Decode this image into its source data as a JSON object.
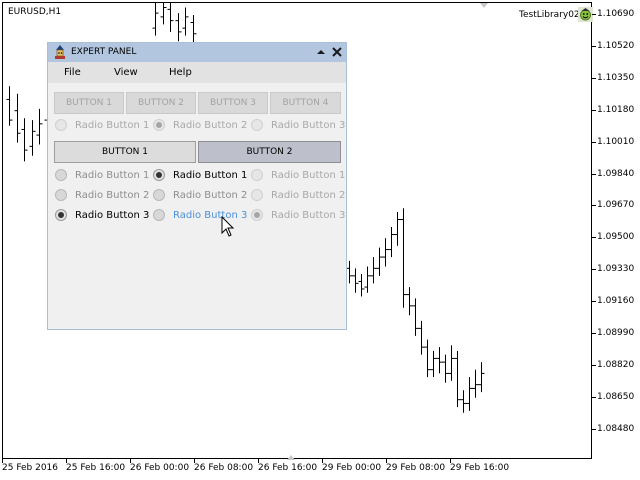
{
  "chart": {
    "symbol": "EURUSD,H1",
    "expert_name": "TestLibrary02",
    "price_labels": [
      "1.10690",
      "1.10520",
      "1.10350",
      "1.10180",
      "1.10010",
      "1.09840",
      "1.09670",
      "1.09500",
      "1.09330",
      "1.09160",
      "1.08990",
      "1.08820",
      "1.08650",
      "1.08480"
    ],
    "date_labels": [
      "25 Feb 2016",
      "25 Feb 16:00",
      "26 Feb 00:00",
      "26 Feb 08:00",
      "26 Feb 16:00",
      "29 Feb 00:00",
      "29 Feb 08:00",
      "29 Feb 16:00"
    ]
  },
  "panel": {
    "title": "EXPERT PANEL",
    "menu": [
      {
        "label": "File"
      },
      {
        "label": "View"
      },
      {
        "label": "Help"
      }
    ],
    "disabled_buttons": [
      {
        "label": "BUTTON 1"
      },
      {
        "label": "BUTTON 2"
      },
      {
        "label": "BUTTON 3"
      },
      {
        "label": "BUTTON 4"
      }
    ],
    "disabled_radios": [
      {
        "label": "Radio Button 1",
        "checked": false
      },
      {
        "label": "Radio Button 2",
        "checked": true
      },
      {
        "label": "Radio Button 3",
        "checked": false
      }
    ],
    "tab_buttons": [
      {
        "label": "BUTTON 1",
        "pressed": false
      },
      {
        "label": "BUTTON 2",
        "pressed": true
      }
    ],
    "radio_columns": [
      {
        "items": [
          {
            "label": "Radio Button 1",
            "checked": false,
            "state": "inactive"
          },
          {
            "label": "Radio Button 2",
            "checked": false,
            "state": "inactive"
          },
          {
            "label": "Radio Button 3",
            "checked": true,
            "state": "active"
          }
        ]
      },
      {
        "items": [
          {
            "label": "Radio Button 1",
            "checked": true,
            "state": "active"
          },
          {
            "label": "Radio Button 2",
            "checked": false,
            "state": "inactive"
          },
          {
            "label": "Radio Button 3",
            "checked": false,
            "state": "hover"
          }
        ]
      },
      {
        "items": [
          {
            "label": "Radio Button 1",
            "checked": false,
            "state": "disabled"
          },
          {
            "label": "Radio Button 2",
            "checked": false,
            "state": "disabled"
          },
          {
            "label": "Radio Button 3",
            "checked": true,
            "state": "disabled"
          }
        ]
      }
    ]
  },
  "colors": {
    "header_bg": "#b3c6e0",
    "hover_text": "#4a90d9"
  },
  "chart_data": {
    "type": "ohlc",
    "title": "EURUSD,H1",
    "y_tick_labels": [
      "1.10690",
      "1.10520",
      "1.10350",
      "1.10180",
      "1.10010",
      "1.09840",
      "1.09670",
      "1.09500",
      "1.09330",
      "1.09160",
      "1.08990",
      "1.08820",
      "1.08650",
      "1.08480"
    ],
    "x_tick_labels": [
      "25 Feb 2016",
      "25 Feb 16:00",
      "26 Feb 00:00",
      "26 Feb 08:00",
      "26 Feb 16:00",
      "29 Feb 00:00",
      "29 Feb 08:00",
      "29 Feb 16:00"
    ],
    "series": [
      {
        "segment": "left",
        "bars": [
          [
            1.1024,
            1.1013,
            1.1031,
            1.101
          ],
          [
            1.1018,
            1.1006,
            1.1027,
            1.1001
          ],
          [
            1.1008,
            1.0997,
            1.1014,
            1.0991
          ],
          [
            1.0999,
            1.1007,
            1.1013,
            1.0994
          ],
          [
            1.1005,
            1.1011,
            1.1019,
            1.1
          ],
          [
            1.1013,
            1.102,
            1.1027,
            1.1008
          ]
        ]
      },
      {
        "segment": "top",
        "bars": [
          [
            1.1062,
            1.107,
            1.1076,
            1.1058
          ],
          [
            1.1068,
            1.1073,
            1.1079,
            1.1064
          ],
          [
            1.1072,
            1.1066,
            1.1077,
            1.106
          ],
          [
            1.1066,
            1.106,
            1.107,
            1.1055
          ],
          [
            1.1062,
            1.1068,
            1.1073,
            1.1058
          ],
          [
            1.1065,
            1.1059,
            1.1069,
            1.1054
          ]
        ]
      },
      {
        "segment": "right",
        "bars": [
          [
            1.0934,
            1.093,
            1.0938,
            1.0926
          ],
          [
            1.093,
            1.0926,
            1.0934,
            1.0921
          ],
          [
            1.0927,
            1.0923,
            1.0931,
            1.0919
          ],
          [
            1.0924,
            1.093,
            1.0935,
            1.0921
          ],
          [
            1.093,
            1.0934,
            1.094,
            1.0926
          ],
          [
            1.0934,
            1.094,
            1.0945,
            1.093
          ],
          [
            1.094,
            1.0944,
            1.095,
            1.0935
          ],
          [
            1.0944,
            1.0952,
            1.0956,
            1.094
          ],
          [
            1.0952,
            1.096,
            1.0964,
            1.0946
          ],
          [
            1.096,
            1.092,
            1.0966,
            1.0913
          ],
          [
            1.092,
            1.0914,
            1.0924,
            1.0909
          ],
          [
            1.0914,
            1.0902,
            1.0918,
            1.0898
          ],
          [
            1.0902,
            1.0892,
            1.0906,
            1.0888
          ],
          [
            1.0892,
            1.088,
            1.0896,
            1.0876
          ],
          [
            1.088,
            1.0886,
            1.089,
            1.0876
          ],
          [
            1.0886,
            1.0884,
            1.0892,
            1.0878
          ],
          [
            1.0884,
            1.0878,
            1.0888,
            1.0873
          ],
          [
            1.0878,
            1.0886,
            1.0893,
            1.0874
          ],
          [
            1.0886,
            1.0864,
            1.089,
            1.086
          ],
          [
            1.0864,
            1.0862,
            1.0869,
            1.0857
          ],
          [
            1.0862,
            1.087,
            1.0876,
            1.0858
          ],
          [
            1.087,
            1.0872,
            1.088,
            1.0865
          ],
          [
            1.0872,
            1.0878,
            1.0884,
            1.0868
          ]
        ]
      }
    ]
  }
}
